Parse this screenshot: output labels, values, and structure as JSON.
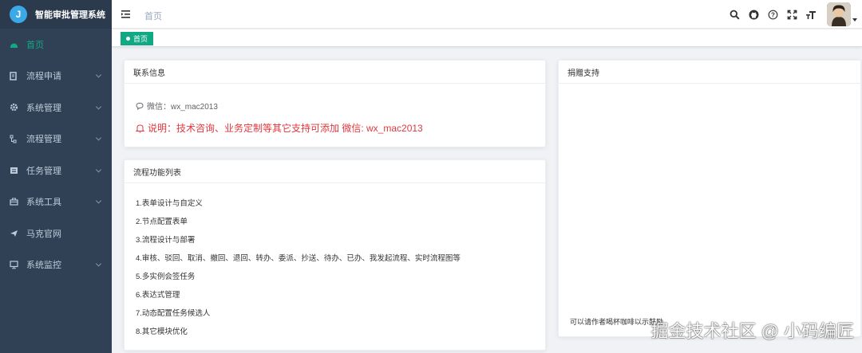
{
  "app": {
    "title": "智能审批管理系统",
    "logo_char": "J"
  },
  "sidebar": {
    "items": [
      {
        "label": "首页",
        "active": true,
        "icon": "dashboard-icon",
        "has_arrow": false
      },
      {
        "label": "流程申请",
        "icon": "document-icon",
        "has_arrow": true
      },
      {
        "label": "系统管理",
        "icon": "gear-icon",
        "has_arrow": true
      },
      {
        "label": "流程管理",
        "icon": "flow-icon",
        "has_arrow": true
      },
      {
        "label": "任务管理",
        "icon": "task-icon",
        "has_arrow": true
      },
      {
        "label": "系统工具",
        "icon": "toolbox-icon",
        "has_arrow": true
      },
      {
        "label": "马克官网",
        "icon": "send-icon",
        "has_arrow": false
      },
      {
        "label": "系统监控",
        "icon": "monitor-icon",
        "has_arrow": true
      }
    ]
  },
  "navbar": {
    "breadcrumb": "首页",
    "icons": [
      "search-icon",
      "github-icon",
      "help-icon",
      "fullscreen-icon",
      "font-size-icon"
    ]
  },
  "tags": {
    "active_tag": "首页"
  },
  "contact_card": {
    "title": "联系信息",
    "wechat": "微信：wx_mac2013",
    "notice": "说明：技术咨询、业务定制等其它支持可添加 微信: wx_mac2013"
  },
  "flow_card": {
    "title": "流程功能列表",
    "items": [
      "1.表单设计与自定义",
      "2.节点配置表单",
      "3.流程设计与部署",
      "4.审核、驳回、取消、撤回、退回、转办、委派、抄送、待办、已办、我发起流程、实时流程图等",
      "5.多实例会签任务",
      "6.表达式管理",
      "7.动态配置任务候选人",
      "8.其它模块优化"
    ]
  },
  "donate_card": {
    "title": "捐赠支持",
    "note": "可以请作者喝杯咖啡以示鼓励"
  },
  "watermark": "掘金技术社区 @ 小码编匠",
  "colors": {
    "sidebar_bg": "#304156",
    "accent": "#11a983",
    "warning": "#e0383e"
  }
}
